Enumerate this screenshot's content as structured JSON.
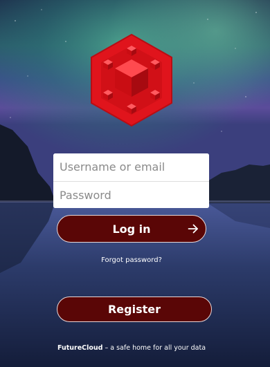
{
  "app": {
    "brand": "FutureCloud",
    "tagline": " – a safe home for all your data"
  },
  "login": {
    "username_placeholder": "Username or email",
    "username_value": "",
    "password_placeholder": "Password",
    "password_value": "",
    "login_label": "Log in",
    "forgot_label": "Forgot password?"
  },
  "register": {
    "register_label": "Register"
  },
  "icons": {
    "logo": "red-cube-hexagon-logo",
    "submit": "arrow-right-icon"
  },
  "colors": {
    "button_fill": "#5a0606",
    "logo_red": "#e0141c"
  }
}
